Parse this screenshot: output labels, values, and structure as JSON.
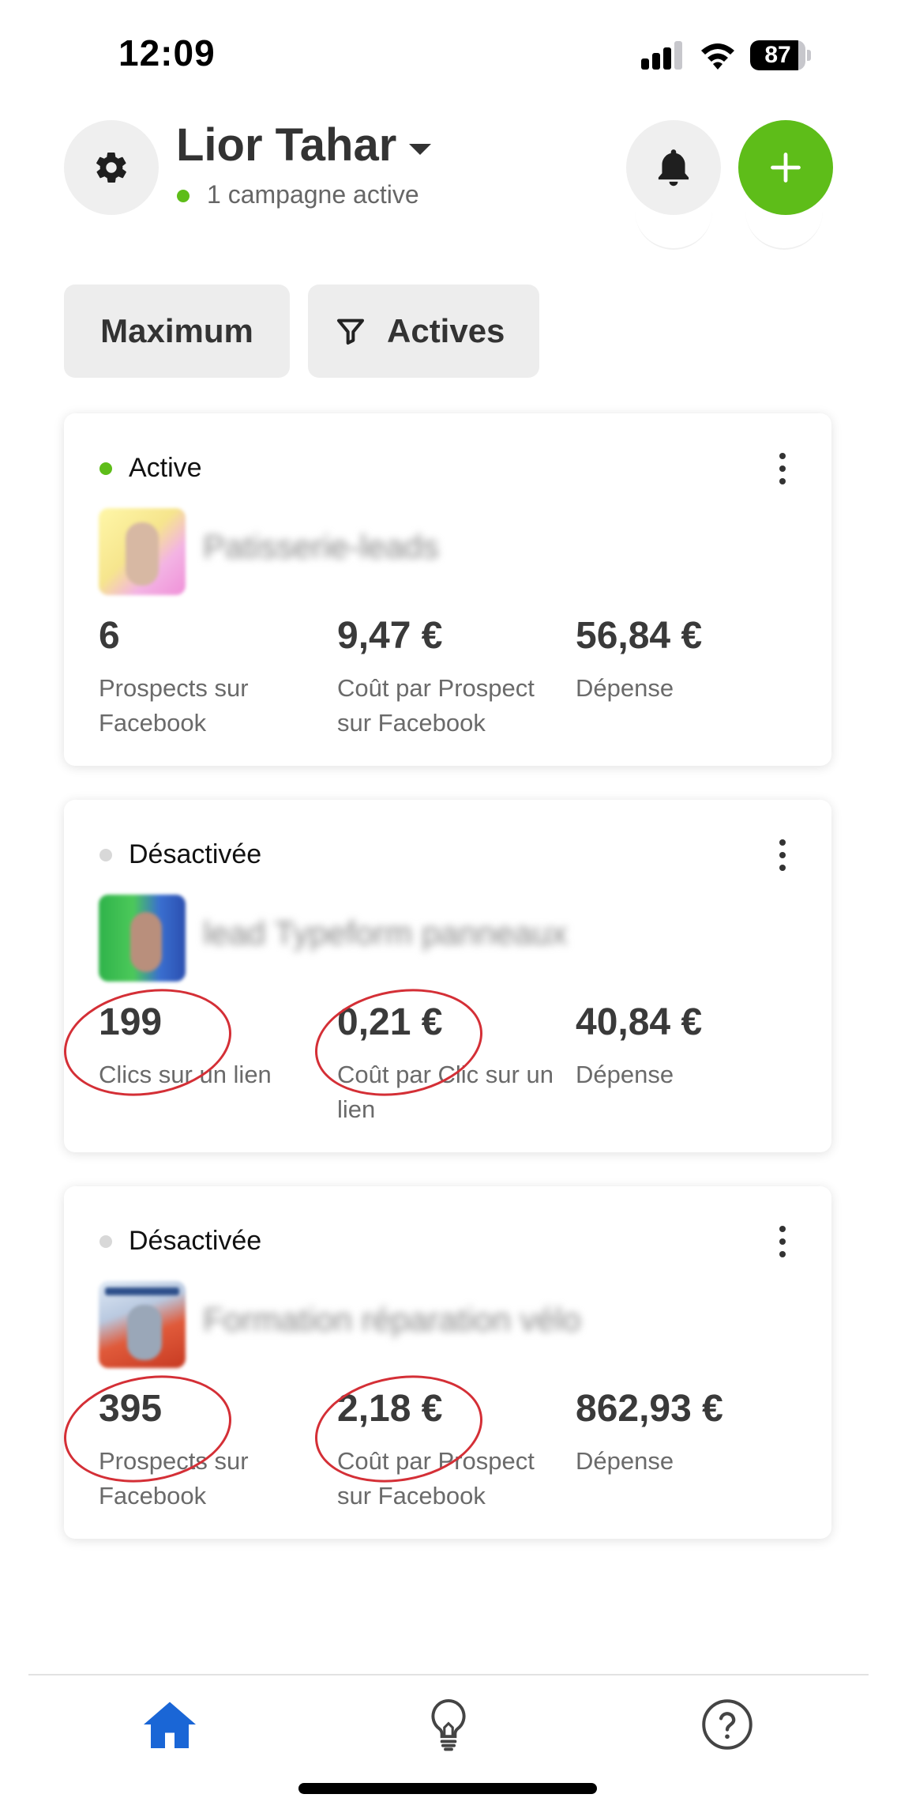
{
  "status_bar": {
    "time": "12:09",
    "battery_percent": "87",
    "battery_level": 0.87
  },
  "header": {
    "account_name": "Lior Tahar",
    "campaign_status": "1 campagne active",
    "icons": {
      "settings": "gear-icon",
      "notifications": "bell-icon",
      "add": "plus-icon"
    }
  },
  "filters": {
    "range_label": "Maximum",
    "status_filter_label": "Actives",
    "status_filter_icon": "filter-icon"
  },
  "campaigns": [
    {
      "status": "Active",
      "status_color": "#5ebd19",
      "name": "Patisserie-leads",
      "metrics": [
        {
          "value": "6",
          "label": "Prospects sur Facebook"
        },
        {
          "value": "9,47 €",
          "label": "Coût par Prospect sur Facebook"
        },
        {
          "value": "56,84 €",
          "label": "Dépense"
        }
      ]
    },
    {
      "status": "Désactivée",
      "status_color": "#d8d8d8",
      "name": "lead Typeform panneaux",
      "metrics": [
        {
          "value": "199",
          "label": "Clics sur un lien"
        },
        {
          "value": "0,21 €",
          "label": "Coût par Clic sur un lien"
        },
        {
          "value": "40,84 €",
          "label": "Dépense"
        }
      ]
    },
    {
      "status": "Désactivée",
      "status_color": "#d8d8d8",
      "name": "Formation réparation vélo",
      "metrics": [
        {
          "value": "395",
          "label": "Prospects sur Facebook"
        },
        {
          "value": "2,18 €",
          "label": "Coût par Prospect sur Facebook"
        },
        {
          "value": "862,93 €",
          "label": "Dépense"
        }
      ]
    }
  ],
  "bottom_nav": {
    "items": [
      {
        "icon": "home-icon",
        "active": true
      },
      {
        "icon": "lightbulb-icon",
        "active": false
      },
      {
        "icon": "help-icon",
        "active": false
      }
    ],
    "active_color": "#1a66d6"
  },
  "colors": {
    "accent_green": "#5ebd19",
    "annotation_red": "#d42f36"
  }
}
